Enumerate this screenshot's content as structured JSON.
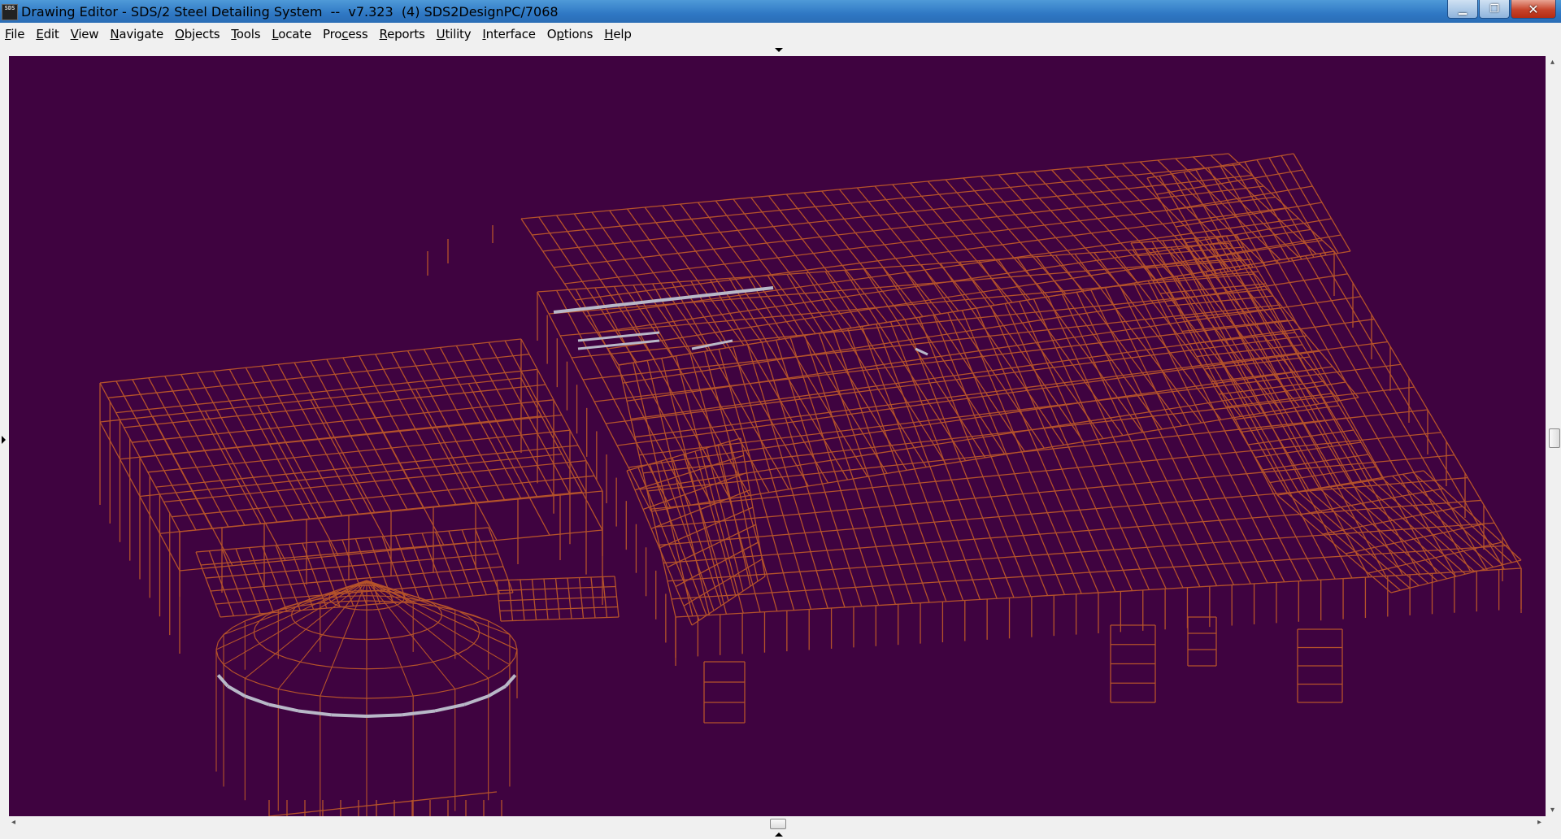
{
  "window": {
    "title": "Drawing Editor - SDS/2 Steel Detailing System  --  v7.323  (4) SDS2DesignPC/7068",
    "icon_label": "SDS",
    "minimize_glyph": "▁",
    "maximize_glyph": "❐",
    "close_glyph": "✕"
  },
  "menu": [
    {
      "mnemonic": "F",
      "rest": "ile"
    },
    {
      "mnemonic": "E",
      "rest": "dit"
    },
    {
      "mnemonic": "V",
      "rest": "iew"
    },
    {
      "mnemonic": "N",
      "rest": "avigate"
    },
    {
      "mnemonic": "O",
      "rest": "bjects"
    },
    {
      "mnemonic": "T",
      "rest": "ools"
    },
    {
      "mnemonic": "L",
      "rest": "ocate"
    },
    {
      "pre": "Pro",
      "mnemonic": "c",
      "rest": "ess"
    },
    {
      "mnemonic": "R",
      "rest": "eports"
    },
    {
      "mnemonic": "U",
      "rest": "tility"
    },
    {
      "mnemonic": "I",
      "rest": "nterface"
    },
    {
      "pre": "O",
      "mnemonic": "p",
      "rest": "tions"
    },
    {
      "mnemonic": "H",
      "rest": "elp"
    }
  ],
  "colors": {
    "viewport_background": "#3f0340",
    "steel_member": "#b5532a",
    "selected_member": "#b8b8c8"
  },
  "icons": {
    "vscroll_up": "▴",
    "vscroll_down": "▾",
    "hscroll_left": "◂",
    "hscroll_right": "▸",
    "thumb_grip": "|||"
  }
}
